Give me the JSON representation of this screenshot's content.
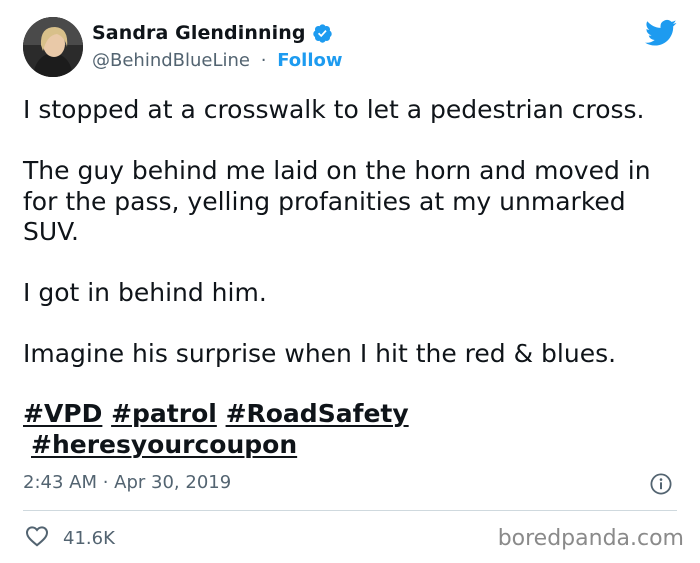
{
  "author": {
    "display_name": "Sandra Glendinning",
    "handle": "@BehindBlueLine",
    "separator": "·",
    "follow_label": "Follow"
  },
  "tweet": {
    "paragraphs": [
      "I stopped at a crosswalk to let a pedestrian cross.",
      "The guy behind me laid on the horn and moved in\nfor the pass, yelling profanities at my unmarked\nSUV.",
      "I got in behind him.",
      "Imagine his surprise when I hit the red & blues."
    ],
    "hashtags": [
      "#VPD",
      "#patrol",
      "#RoadSafety",
      "#heresyourcoupon"
    ],
    "timestamp": "2:43 AM · Apr 30, 2019"
  },
  "engagement": {
    "likes": "41.6K"
  },
  "watermark": "boredpanda.com",
  "colors": {
    "brand_blue": "#1d9bf0",
    "text_primary": "#0f1419",
    "text_secondary": "#536471",
    "divider": "#cfd9de"
  },
  "icons": [
    "avatar",
    "verified-badge-icon",
    "twitter-bird-icon",
    "info-icon",
    "heart-icon"
  ]
}
